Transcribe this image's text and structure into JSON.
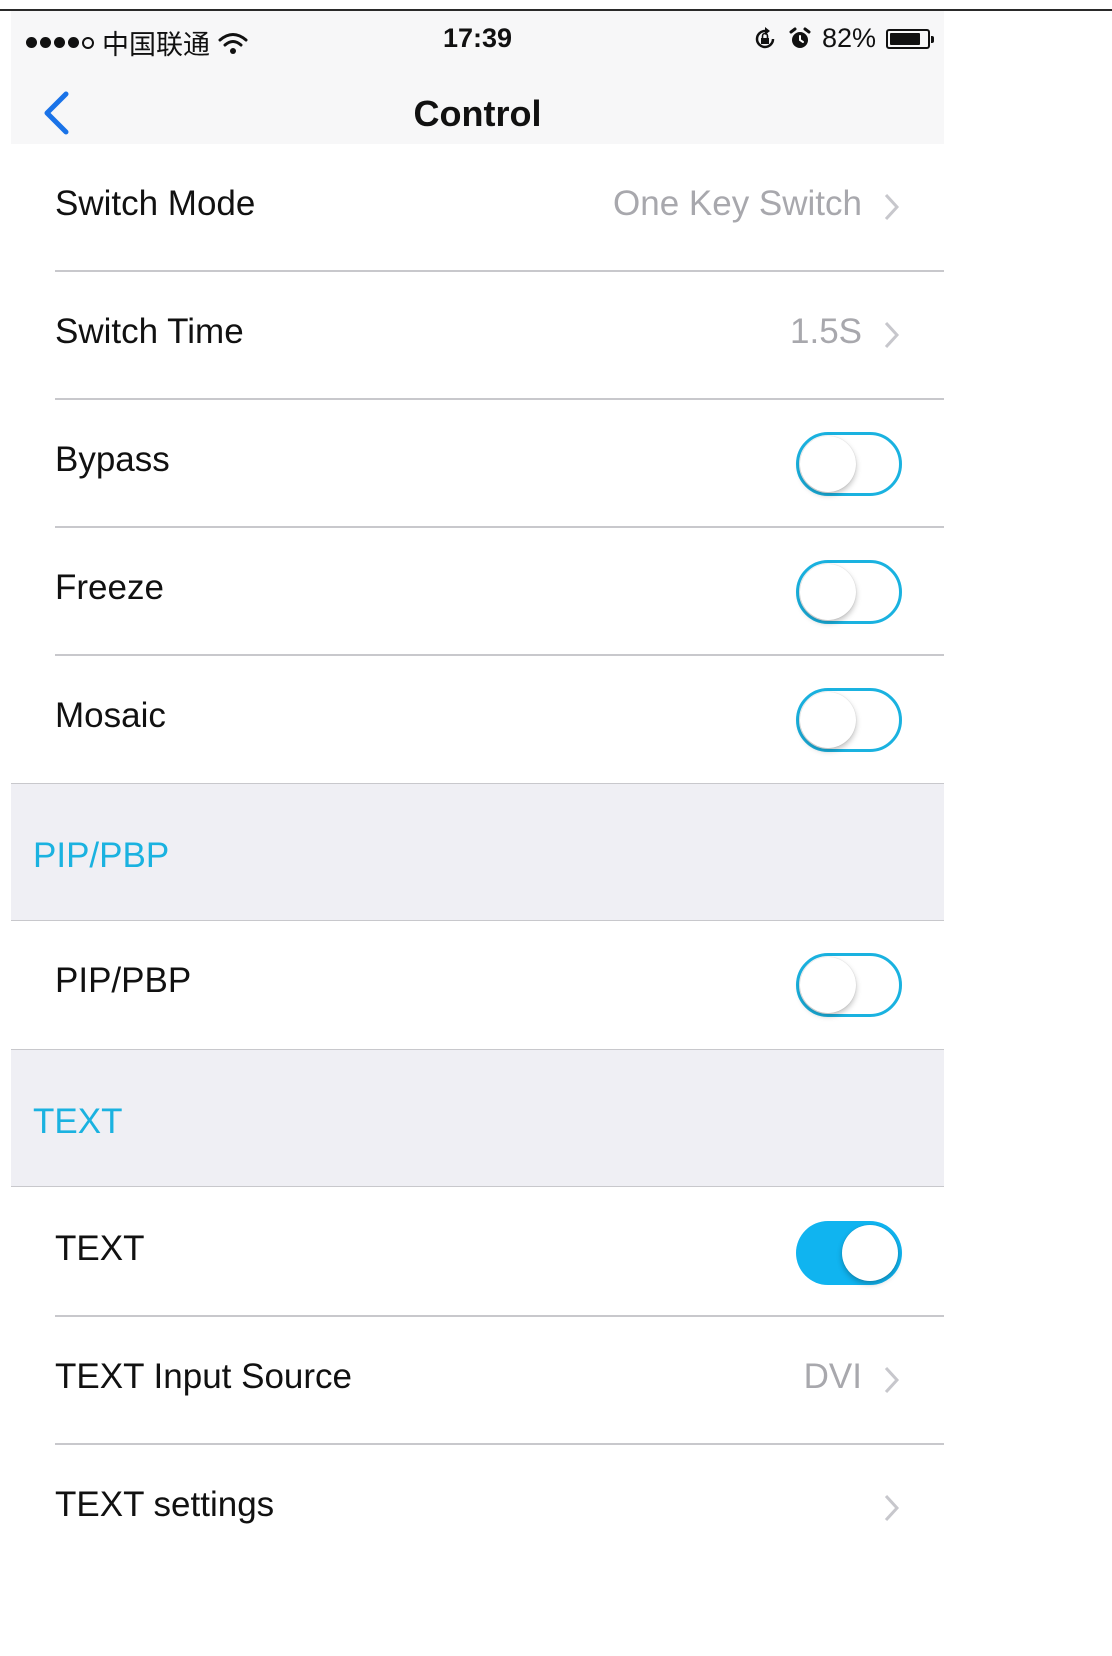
{
  "status_bar": {
    "carrier": "中国联通",
    "time": "17:39",
    "battery": "82%",
    "battery_level": 0.82,
    "icons": [
      "signal-dots",
      "wifi-icon",
      "rotation-lock-icon",
      "alarm-icon",
      "battery-icon"
    ]
  },
  "navbar": {
    "title": "Control",
    "back_icon": "chevron-left-icon",
    "accent": "#1a73e8"
  },
  "rows": {
    "switch_mode": {
      "label": "Switch Mode",
      "value": "One Key Switch"
    },
    "switch_time": {
      "label": "Switch Time",
      "value": "1.5S"
    },
    "bypass": {
      "label": "Bypass",
      "on": false
    },
    "freeze": {
      "label": "Freeze",
      "on": false
    },
    "mosaic": {
      "label": "Mosaic",
      "on": false
    },
    "pip_pbp": {
      "label": "PIP/PBP",
      "on": false
    },
    "text": {
      "label": "TEXT",
      "on": true
    },
    "text_input_source": {
      "label": "TEXT Input Source",
      "value": "DVI"
    },
    "text_settings": {
      "label": "TEXT settings"
    }
  },
  "sections": {
    "pip_pbp": {
      "title": "PIP/PBP"
    },
    "text": {
      "title": "TEXT"
    }
  },
  "colors": {
    "section_title": "#1ab2e0",
    "toggle_on": "#10b4f0",
    "toggle_off_border": "#1ab2e0",
    "value_text": "#a8a8ad",
    "section_bg": "#efeff4"
  }
}
